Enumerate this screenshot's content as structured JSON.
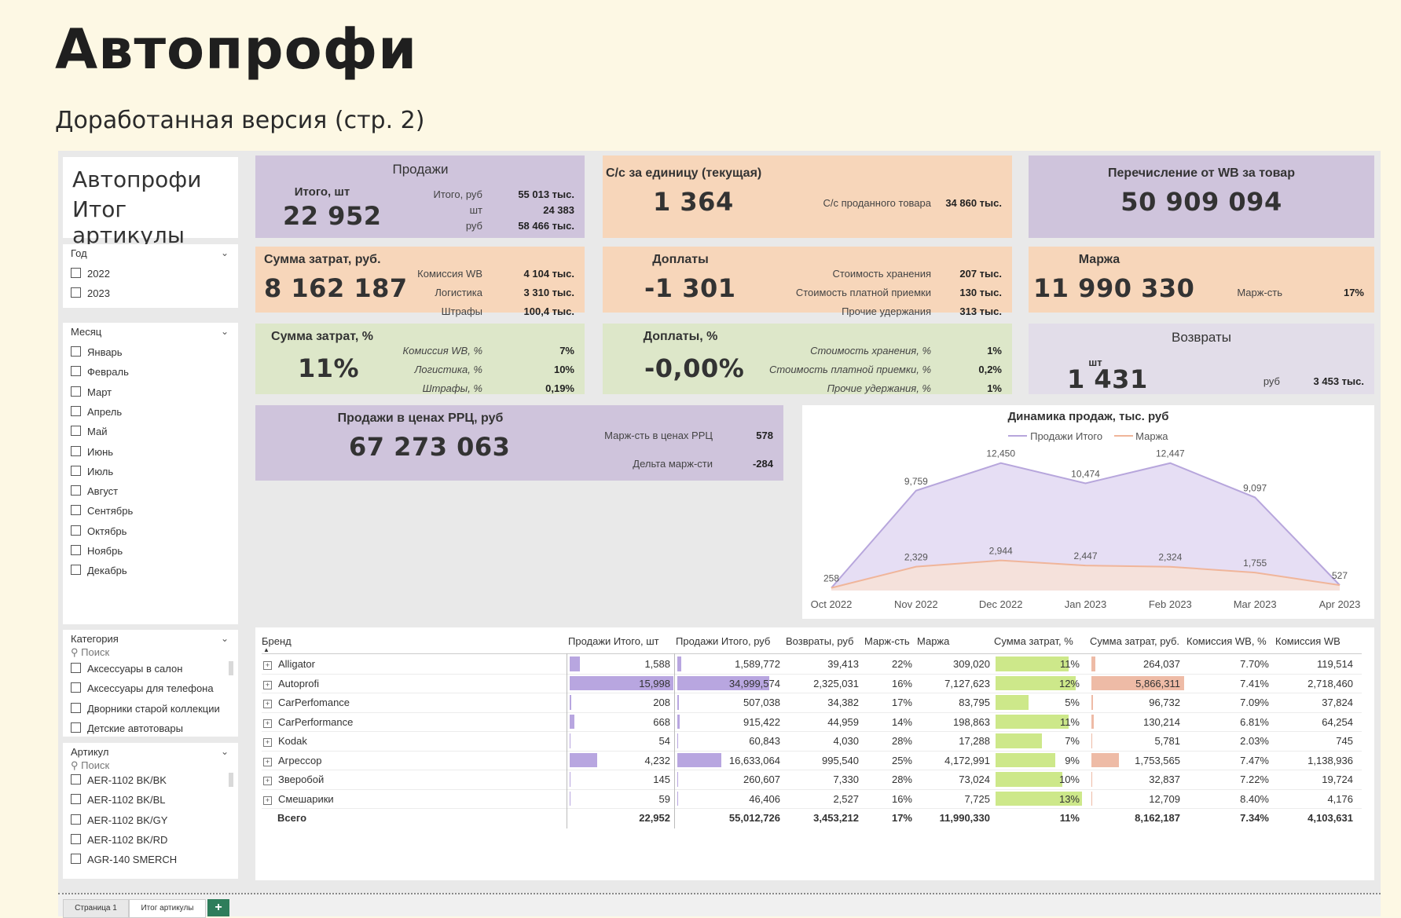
{
  "page": {
    "title": "Автопрофи",
    "subtitle": "Доработанная версия (стр. 2)"
  },
  "report": {
    "title_line1": "Автопрофи",
    "title_line2": "Итог артикулы"
  },
  "kpi": {
    "sales": {
      "header": "Продажи",
      "qty_label": "Итого, шт",
      "qty_value": "22 952",
      "rows": [
        {
          "label": "Итого, руб",
          "value": "55 013 тыс."
        },
        {
          "label": "шт",
          "value": "24 383"
        },
        {
          "label": "руб",
          "value": "58 466 тыс."
        }
      ]
    },
    "unit_cost": {
      "header": "С/с за единицу (текущая)",
      "value": "1 364",
      "sub_label": "С/с проданного товара",
      "sub_value": "34 860 тыс."
    },
    "wb_transfer": {
      "header": "Перечисление от WB за товар",
      "value": "50 909 094"
    },
    "costs": {
      "header": "Сумма затрат, руб.",
      "value": "8 162 187",
      "rows": [
        {
          "label": "Комиссия WB",
          "value": "4 104 тыс."
        },
        {
          "label": "Логистика",
          "value": "3 310 тыс."
        },
        {
          "label": "Штрафы",
          "value": "100,4 тыс."
        }
      ]
    },
    "surcharges": {
      "header": "Доплаты",
      "value": "-1 301",
      "rows": [
        {
          "label": "Стоимость хранения",
          "value": "207 тыс."
        },
        {
          "label": "Стоимость платной приемки",
          "value": "130 тыс."
        },
        {
          "label": "Прочие удержания",
          "value": "313 тыс."
        }
      ]
    },
    "margin": {
      "header": "Маржа",
      "value": "11 990 330",
      "sub_label": "Марж-сть",
      "sub_value": "17%"
    },
    "costs_pct": {
      "header": "Сумма затрат, %",
      "value": "11%",
      "rows": [
        {
          "label": "Комиссия WB, %",
          "value": "7%"
        },
        {
          "label": "Логистика, %",
          "value": "10%"
        },
        {
          "label": "Штрафы, %",
          "value": "0,19%"
        }
      ]
    },
    "surcharges_pct": {
      "header": "Доплаты, %",
      "value": "-0,00%",
      "rows": [
        {
          "label": "Стоимость хранения, %",
          "value": "1%"
        },
        {
          "label": "Стоимость платной приемки, %",
          "value": "0,2%"
        },
        {
          "label": "Прочие удержания, %",
          "value": "1%"
        }
      ]
    },
    "returns": {
      "header": "Возвраты",
      "qty_label": "шт",
      "qty_value": "1 431",
      "rub_label": "руб",
      "rub_value": "3 453 тыс."
    },
    "rrp": {
      "header": "Продажи в ценах РРЦ, руб",
      "value": "67 273 063",
      "rows": [
        {
          "label": "Марж-сть в ценах РРЦ",
          "value": "578"
        },
        {
          "label": "Дельта марж-сти",
          "value": "-284"
        }
      ]
    }
  },
  "slicers": {
    "year": {
      "title": "Год",
      "items": [
        "2022",
        "2023"
      ]
    },
    "month": {
      "title": "Месяц",
      "items": [
        "Январь",
        "Февраль",
        "Март",
        "Апрель",
        "Май",
        "Июнь",
        "Июль",
        "Август",
        "Сентябрь",
        "Октябрь",
        "Ноябрь",
        "Декабрь"
      ]
    },
    "category": {
      "title": "Категория",
      "search": "Поиск",
      "items": [
        "Аксессуары в салон",
        "Аксессуары для телефона",
        "Дворники старой коллекции",
        "Детские автотовары"
      ]
    },
    "article": {
      "title": "Артикул",
      "search": "Поиск",
      "items": [
        "AER-1102 BK/BK",
        "AER-1102 BK/BL",
        "AER-1102 BK/GY",
        "AER-1102 BK/RD",
        "AGR-140 SMERCH"
      ]
    }
  },
  "chart_data": {
    "type": "area",
    "title": "Динамика продаж, тыс. руб",
    "legend_position": "top-center",
    "categories": [
      "Oct 2022",
      "Nov 2022",
      "Dec 2022",
      "Jan 2023",
      "Feb 2023",
      "Mar 2023",
      "Apr 2023"
    ],
    "series": [
      {
        "name": "Продажи Итого",
        "color": "#b7a6dc",
        "values": [
          258,
          9759,
          12450,
          10474,
          12447,
          9097,
          527
        ]
      },
      {
        "name": "Маржа",
        "color": "#f0b59a",
        "values": [
          258,
          2329,
          2944,
          2447,
          2324,
          1755,
          527
        ]
      }
    ],
    "labels": {
      "sales": [
        "",
        "9,759",
        "12,450",
        "10,474",
        "12,447",
        "9,097",
        "527"
      ],
      "margin": [
        "258",
        "2,329",
        "2,944",
        "2,447",
        "2,324",
        "1,755",
        ""
      ]
    },
    "ylim": [
      0,
      13500
    ]
  },
  "table": {
    "columns": [
      "Бренд",
      "Продажи Итого, шт",
      "Продажи Итого, руб",
      "Возвраты, руб",
      "Марж-сть",
      "Маржа",
      "Сумма затрат, %",
      "Сумма затрат, руб.",
      "Комиссия WB, %",
      "Комиссия WB"
    ],
    "rows": [
      {
        "brand": "Alligator",
        "qty": "1,588",
        "rub": "1,589,772",
        "ret": "39,413",
        "mpct": "22%",
        "margin": "309,020",
        "cpct": "11%",
        "crub": "264,037",
        "wbpct": "7.70%",
        "wb": "119,514",
        "qty_n": 1588,
        "rub_n": 1589772,
        "cpct_n": 11,
        "crub_n": 264037
      },
      {
        "brand": "Autoprofi",
        "qty": "15,998",
        "rub": "34,999,574",
        "ret": "2,325,031",
        "mpct": "16%",
        "margin": "7,127,623",
        "cpct": "12%",
        "crub": "5,866,311",
        "wbpct": "7.41%",
        "wb": "2,718,460",
        "qty_n": 15998,
        "rub_n": 34999574,
        "cpct_n": 12,
        "crub_n": 5866311
      },
      {
        "brand": "CarPerfomance",
        "qty": "208",
        "rub": "507,038",
        "ret": "34,382",
        "mpct": "17%",
        "margin": "83,795",
        "cpct": "5%",
        "crub": "96,732",
        "wbpct": "7.09%",
        "wb": "37,824",
        "qty_n": 208,
        "rub_n": 507038,
        "cpct_n": 5,
        "crub_n": 96732
      },
      {
        "brand": "CarPerformance",
        "qty": "668",
        "rub": "915,422",
        "ret": "44,959",
        "mpct": "14%",
        "margin": "198,863",
        "cpct": "11%",
        "crub": "130,214",
        "wbpct": "6.81%",
        "wb": "64,254",
        "qty_n": 668,
        "rub_n": 915422,
        "cpct_n": 11,
        "crub_n": 130214
      },
      {
        "brand": "Kodak",
        "qty": "54",
        "rub": "60,843",
        "ret": "4,030",
        "mpct": "28%",
        "margin": "17,288",
        "cpct": "7%",
        "crub": "5,781",
        "wbpct": "2.03%",
        "wb": "745",
        "qty_n": 54,
        "rub_n": 60843,
        "cpct_n": 7,
        "crub_n": 5781
      },
      {
        "brand": "Агрессор",
        "qty": "4,232",
        "rub": "16,633,064",
        "ret": "995,540",
        "mpct": "25%",
        "margin": "4,172,991",
        "cpct": "9%",
        "crub": "1,753,565",
        "wbpct": "7.47%",
        "wb": "1,138,936",
        "qty_n": 4232,
        "rub_n": 16633064,
        "cpct_n": 9,
        "crub_n": 1753565
      },
      {
        "brand": "Зверобой",
        "qty": "145",
        "rub": "260,607",
        "ret": "7,330",
        "mpct": "28%",
        "margin": "73,024",
        "cpct": "10%",
        "crub": "32,837",
        "wbpct": "7.22%",
        "wb": "19,724",
        "qty_n": 145,
        "rub_n": 260607,
        "cpct_n": 10,
        "crub_n": 32837
      },
      {
        "brand": "Смешарики",
        "qty": "59",
        "rub": "46,406",
        "ret": "2,527",
        "mpct": "16%",
        "margin": "7,725",
        "cpct": "13%",
        "crub": "12,709",
        "wbpct": "8.40%",
        "wb": "4,176",
        "qty_n": 59,
        "rub_n": 46406,
        "cpct_n": 13,
        "crub_n": 12709
      }
    ],
    "total": {
      "brand": "Всего",
      "qty": "22,952",
      "rub": "55,012,726",
      "ret": "3,453,212",
      "mpct": "17%",
      "margin": "11,990,330",
      "cpct": "11%",
      "crub": "8,162,187",
      "wbpct": "7.34%",
      "wb": "4,103,631"
    }
  },
  "tabs": [
    {
      "label": "Страница 1",
      "active": false
    },
    {
      "label": "Итог артикулы",
      "active": true
    }
  ],
  "tab_add_label": "+",
  "colors": {
    "purple": "#cfc4dc",
    "orange": "#f7d6ba",
    "green": "#dde7c9",
    "bar_purple": "#b8a6e0",
    "bar_green": "#cde88a",
    "bar_salmon": "#eebba6"
  }
}
